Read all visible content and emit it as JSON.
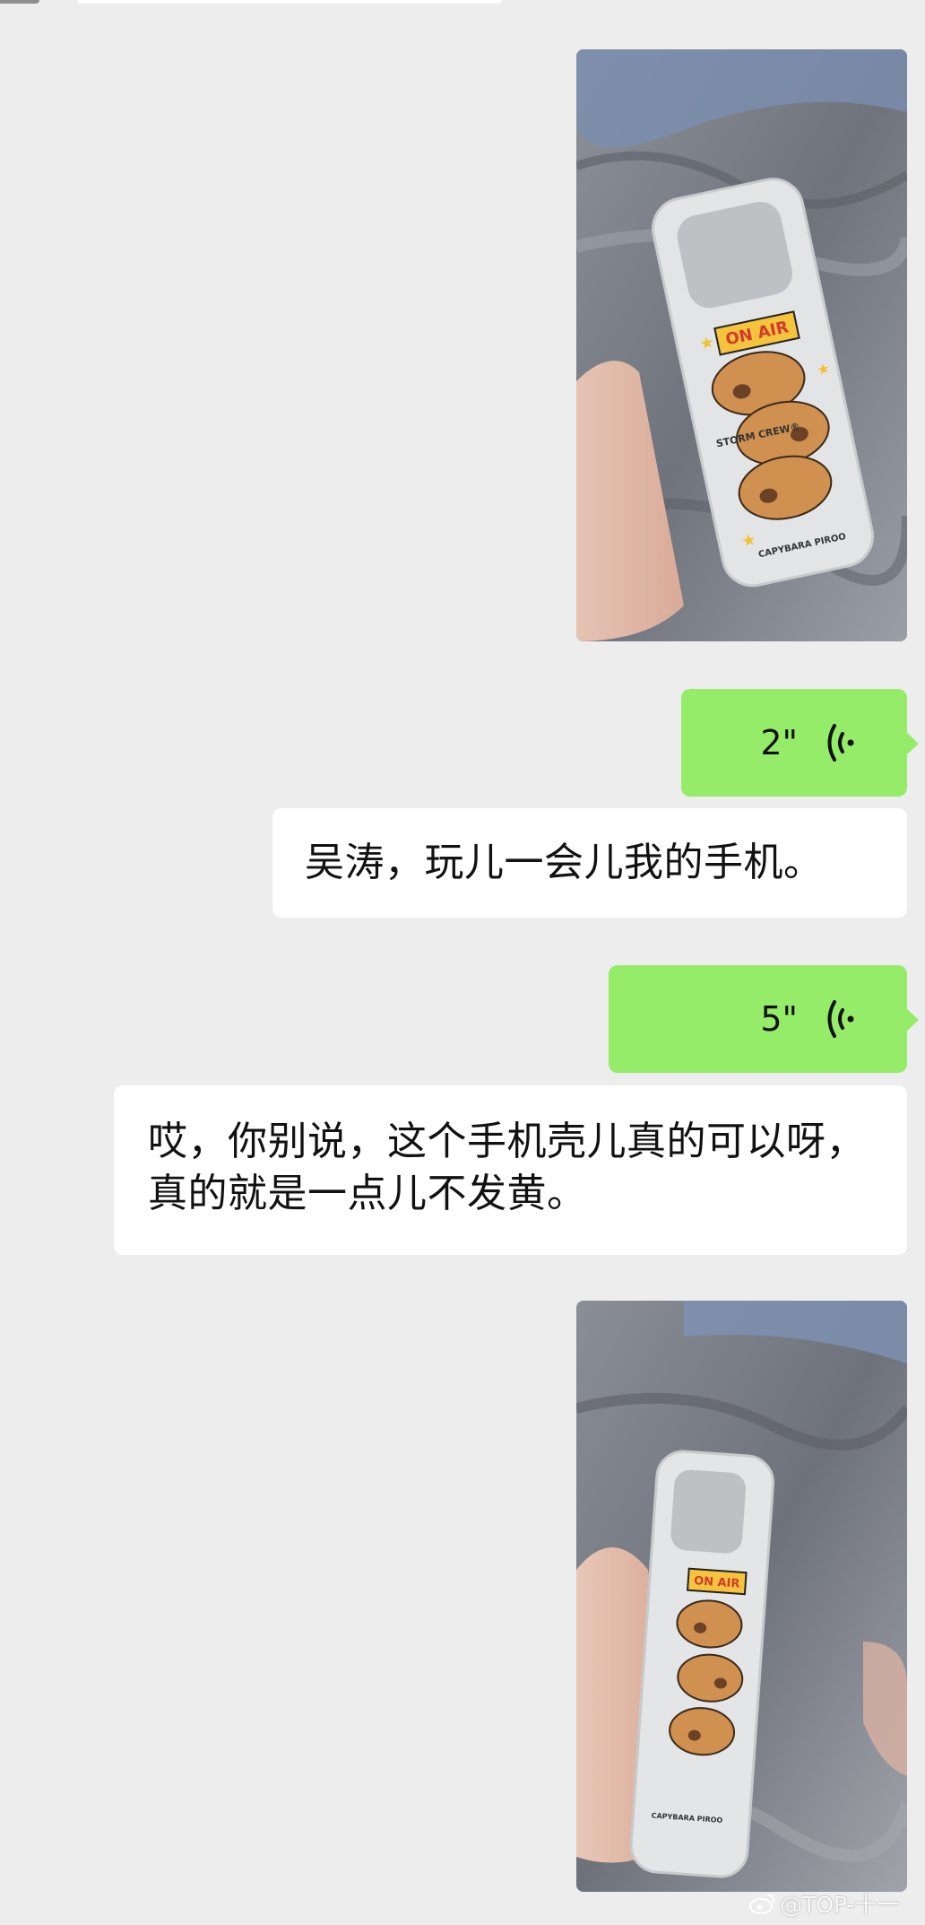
{
  "messages": [
    {
      "kind": "image",
      "description_icon": "phone-case-photo"
    },
    {
      "kind": "voice",
      "duration": "2\""
    },
    {
      "kind": "text",
      "text": "吴涛，玩儿一会儿我的手机。"
    },
    {
      "kind": "voice",
      "duration": "5\""
    },
    {
      "kind": "text",
      "text": "哎，你别说，这个手机壳儿真的可以呀，真的就是一点儿不发黄。"
    },
    {
      "kind": "image",
      "description_icon": "phone-case-photo"
    }
  ],
  "case_print": {
    "badge": "ON AIR",
    "side_text": "STORM CREW®",
    "brand": "CAPYBARA PIROO"
  },
  "watermark": {
    "icon": "weibo-icon",
    "text": "@TOP-十一"
  },
  "colors": {
    "background": "#ededed",
    "voice_bubble": "#95ec69",
    "text_bubble": "#ffffff"
  }
}
